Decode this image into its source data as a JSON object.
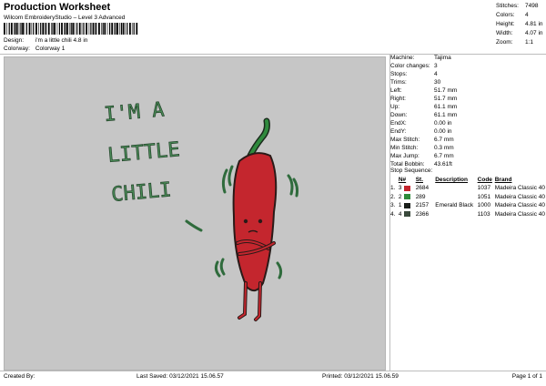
{
  "header": {
    "title": "Production Worksheet",
    "software": "Wilcom EmbroideryStudio – Level 3 Advanced",
    "design_label": "Design:",
    "design_value": "i'm a little chili 4.8 in",
    "colorway_label": "Colorway:",
    "colorway_value": "Colorway 1"
  },
  "summary": {
    "stitches_label": "Stitches:",
    "stitches": "7498",
    "colors_label": "Colors:",
    "colors": "4",
    "height_label": "Height:",
    "height": "4.81 in",
    "width_label": "Width:",
    "width": "4.07 in",
    "zoom_label": "Zoom:",
    "zoom": "1:1"
  },
  "design_text": [
    "I'M A",
    "LITTLE",
    "CHILI"
  ],
  "machine": {
    "machine_label": "Machine:",
    "machine": "Tajima",
    "color_changes_label": "Color changes:",
    "color_changes": "3",
    "stops_label": "Stops:",
    "stops": "4",
    "trims_label": "Trims:",
    "trims": "30",
    "left_label": "Left:",
    "left": "51.7 mm",
    "right_label": "Right:",
    "right": "51.7 mm",
    "up_label": "Up:",
    "up": "61.1 mm",
    "down_label": "Down:",
    "down": "61.1 mm",
    "endx_label": "EndX:",
    "endx": "0.00 in",
    "endy_label": "EndY:",
    "endy": "0.00 in",
    "max_stitch_label": "Max Stitch:",
    "max_stitch": "6.7 mm",
    "min_stitch_label": "Min Stitch:",
    "min_stitch": "0.3 mm",
    "max_jump_label": "Max Jump:",
    "max_jump": "6.7 mm",
    "total_bobbin_label": "Total Bobbin:",
    "total_bobbin": "43.61ft"
  },
  "stop_sequence": {
    "label": "Stop Sequence:",
    "headers": {
      "n": "N#",
      "st": "St.",
      "description": "Description",
      "code": "Code",
      "brand": "Brand"
    },
    "rows": [
      {
        "index": "1.",
        "n": "3",
        "color": "#c4262e",
        "st": "2684",
        "description": "",
        "code": "1037",
        "brand": "Madeira Classic 40"
      },
      {
        "index": "2.",
        "n": "2",
        "color": "#2e8b3a",
        "st": "289",
        "description": "",
        "code": "1051",
        "brand": "Madeira Classic 40"
      },
      {
        "index": "3.",
        "n": "1",
        "color": "#1a1f1a",
        "st": "2157",
        "description": "Emerald Black",
        "code": "1000",
        "brand": "Madeira Classic 40"
      },
      {
        "index": "4.",
        "n": "4",
        "color": "#3a4a3c",
        "st": "2366",
        "description": "",
        "code": "1103",
        "brand": "Madeira Classic 40"
      }
    ]
  },
  "footer": {
    "created": "Created By:",
    "saved": "Last Saved: 03/12/2021 15.06.57",
    "printed": "Printed: 03/12/2021 15.06.59",
    "page": "Page 1 of 1"
  }
}
